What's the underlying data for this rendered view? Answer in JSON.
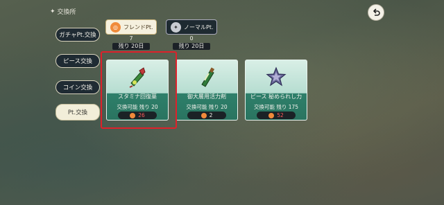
{
  "header": {
    "title": "交換所"
  },
  "tabs": [
    {
      "label": "ガチャPt.交換"
    },
    {
      "label": "ピース交換"
    },
    {
      "label": "コイン交換"
    },
    {
      "label": "Pt.交換"
    }
  ],
  "currencies": {
    "friend": {
      "label": "フレンドPt.",
      "count": "7",
      "remaining": "残り 20日"
    },
    "normal": {
      "label": "ノーマルPt.",
      "count": "0",
      "remaining": "残り 20日"
    }
  },
  "items": [
    {
      "name": "スタミナ回復薬",
      "trade": "交換可能  残り 20",
      "cost": "26",
      "icon": "stamina-potion-icon"
    },
    {
      "name": "御大層用活力剤",
      "trade": "交換可能  残り 20",
      "cost": "2",
      "icon": "bottle-icon"
    },
    {
      "name": "ピース 秘められし力",
      "trade": "交換可能  残り 175",
      "cost": "52",
      "icon": "star-piece-icon"
    }
  ],
  "colors": {
    "selection": "#e0202a",
    "cost_insufficient": "#ff5a5a",
    "card_base": "#2a7460"
  }
}
